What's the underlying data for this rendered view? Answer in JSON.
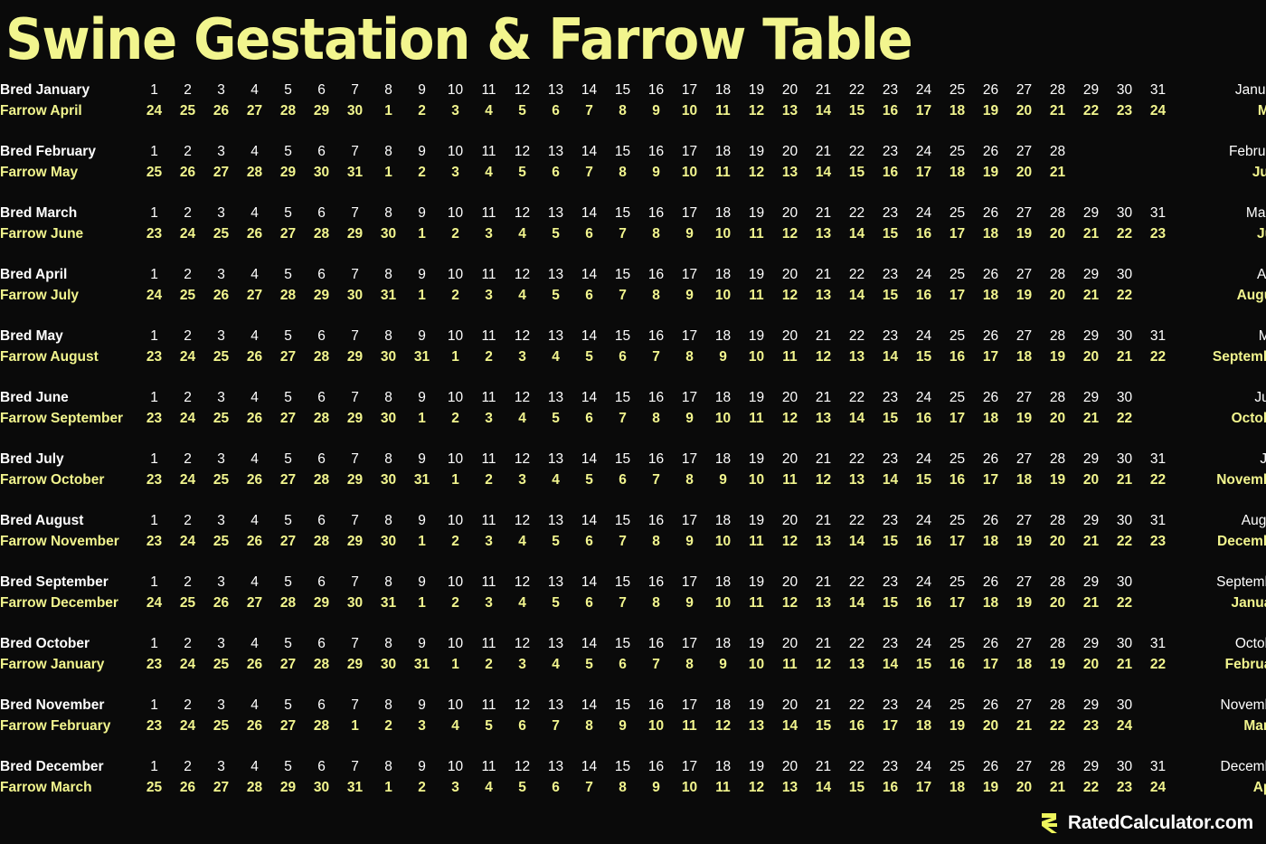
{
  "title": "Swine Gestation & Farrow Table",
  "colors": {
    "background": "#0a0a0a",
    "accent": "#f2f58e",
    "text": "#ffffff"
  },
  "footer": {
    "logo_icon": "rated-calculator-r-logo-icon",
    "brand": "RatedCalculator.com"
  },
  "table": {
    "bred_prefix": "Bred",
    "farrow_prefix": "Farrow",
    "max_columns": 31,
    "rows": [
      {
        "bred_label": "Bred January",
        "farrow_label": "Farrow April",
        "bred_month": "January",
        "farrow_month": "May",
        "bred_days": [
          1,
          2,
          3,
          4,
          5,
          6,
          7,
          8,
          9,
          10,
          11,
          12,
          13,
          14,
          15,
          16,
          17,
          18,
          19,
          20,
          21,
          22,
          23,
          24,
          25,
          26,
          27,
          28,
          29,
          30,
          31
        ],
        "farrow_days": [
          24,
          25,
          26,
          27,
          28,
          29,
          30,
          1,
          2,
          3,
          4,
          5,
          6,
          7,
          8,
          9,
          10,
          11,
          12,
          13,
          14,
          15,
          16,
          17,
          18,
          19,
          20,
          21,
          22,
          23,
          24
        ]
      },
      {
        "bred_label": "Bred February",
        "farrow_label": "Farrow May",
        "bred_month": "February",
        "farrow_month": "June",
        "bred_days": [
          1,
          2,
          3,
          4,
          5,
          6,
          7,
          8,
          9,
          10,
          11,
          12,
          13,
          14,
          15,
          16,
          17,
          18,
          19,
          20,
          21,
          22,
          23,
          24,
          25,
          26,
          27,
          28
        ],
        "farrow_days": [
          25,
          26,
          27,
          28,
          29,
          30,
          31,
          1,
          2,
          3,
          4,
          5,
          6,
          7,
          8,
          9,
          10,
          11,
          12,
          13,
          14,
          15,
          16,
          17,
          18,
          19,
          20,
          21
        ]
      },
      {
        "bred_label": "Bred March",
        "farrow_label": "Farrow June",
        "bred_month": "March",
        "farrow_month": "July",
        "bred_days": [
          1,
          2,
          3,
          4,
          5,
          6,
          7,
          8,
          9,
          10,
          11,
          12,
          13,
          14,
          15,
          16,
          17,
          18,
          19,
          20,
          21,
          22,
          23,
          24,
          25,
          26,
          27,
          28,
          29,
          30,
          31
        ],
        "farrow_days": [
          23,
          24,
          25,
          26,
          27,
          28,
          29,
          30,
          1,
          2,
          3,
          4,
          5,
          6,
          7,
          8,
          9,
          10,
          11,
          12,
          13,
          14,
          15,
          16,
          17,
          18,
          19,
          20,
          21,
          22,
          23
        ]
      },
      {
        "bred_label": "Bred April",
        "farrow_label": "Farrow July",
        "bred_month": "April",
        "farrow_month": "August",
        "bred_days": [
          1,
          2,
          3,
          4,
          5,
          6,
          7,
          8,
          9,
          10,
          11,
          12,
          13,
          14,
          15,
          16,
          17,
          18,
          19,
          20,
          21,
          22,
          23,
          24,
          25,
          26,
          27,
          28,
          29,
          30
        ],
        "farrow_days": [
          24,
          25,
          26,
          27,
          28,
          29,
          30,
          31,
          1,
          2,
          3,
          4,
          5,
          6,
          7,
          8,
          9,
          10,
          11,
          12,
          13,
          14,
          15,
          16,
          17,
          18,
          19,
          20,
          21,
          22
        ]
      },
      {
        "bred_label": "Bred May",
        "farrow_label": "Farrow August",
        "bred_month": "May",
        "farrow_month": "September",
        "bred_days": [
          1,
          2,
          3,
          4,
          5,
          6,
          7,
          8,
          9,
          10,
          11,
          12,
          13,
          14,
          15,
          16,
          17,
          18,
          19,
          20,
          21,
          22,
          23,
          24,
          25,
          26,
          27,
          28,
          29,
          30,
          31
        ],
        "farrow_days": [
          23,
          24,
          25,
          26,
          27,
          28,
          29,
          30,
          31,
          1,
          2,
          3,
          4,
          5,
          6,
          7,
          8,
          9,
          10,
          11,
          12,
          13,
          14,
          15,
          16,
          17,
          18,
          19,
          20,
          21,
          22
        ]
      },
      {
        "bred_label": "Bred June",
        "farrow_label": "Farrow September",
        "bred_month": "June",
        "farrow_month": "October",
        "bred_days": [
          1,
          2,
          3,
          4,
          5,
          6,
          7,
          8,
          9,
          10,
          11,
          12,
          13,
          14,
          15,
          16,
          17,
          18,
          19,
          20,
          21,
          22,
          23,
          24,
          25,
          26,
          27,
          28,
          29,
          30
        ],
        "farrow_days": [
          23,
          24,
          25,
          26,
          27,
          28,
          29,
          30,
          1,
          2,
          3,
          4,
          5,
          6,
          7,
          8,
          9,
          10,
          11,
          12,
          13,
          14,
          15,
          16,
          17,
          18,
          19,
          20,
          21,
          22
        ]
      },
      {
        "bred_label": "Bred July",
        "farrow_label": "Farrow October",
        "bred_month": "July",
        "farrow_month": "November",
        "bred_days": [
          1,
          2,
          3,
          4,
          5,
          6,
          7,
          8,
          9,
          10,
          11,
          12,
          13,
          14,
          15,
          16,
          17,
          18,
          19,
          20,
          21,
          22,
          23,
          24,
          25,
          26,
          27,
          28,
          29,
          30,
          31
        ],
        "farrow_days": [
          23,
          24,
          25,
          26,
          27,
          28,
          29,
          30,
          31,
          1,
          2,
          3,
          4,
          5,
          6,
          7,
          8,
          9,
          10,
          11,
          12,
          13,
          14,
          15,
          16,
          17,
          18,
          19,
          20,
          21,
          22
        ]
      },
      {
        "bred_label": "Bred August",
        "farrow_label": "Farrow November",
        "bred_month": "August",
        "farrow_month": "December",
        "bred_days": [
          1,
          2,
          3,
          4,
          5,
          6,
          7,
          8,
          9,
          10,
          11,
          12,
          13,
          14,
          15,
          16,
          17,
          18,
          19,
          20,
          21,
          22,
          23,
          24,
          25,
          26,
          27,
          28,
          29,
          30,
          31
        ],
        "farrow_days": [
          23,
          24,
          25,
          26,
          27,
          28,
          29,
          30,
          1,
          2,
          3,
          4,
          5,
          6,
          7,
          8,
          9,
          10,
          11,
          12,
          13,
          14,
          15,
          16,
          17,
          18,
          19,
          20,
          21,
          22,
          23
        ]
      },
      {
        "bred_label": "Bred September",
        "farrow_label": "Farrow December",
        "bred_month": "September",
        "farrow_month": "January",
        "bred_days": [
          1,
          2,
          3,
          4,
          5,
          6,
          7,
          8,
          9,
          10,
          11,
          12,
          13,
          14,
          15,
          16,
          17,
          18,
          19,
          20,
          21,
          22,
          23,
          24,
          25,
          26,
          27,
          28,
          29,
          30
        ],
        "farrow_days": [
          24,
          25,
          26,
          27,
          28,
          29,
          30,
          31,
          1,
          2,
          3,
          4,
          5,
          6,
          7,
          8,
          9,
          10,
          11,
          12,
          13,
          14,
          15,
          16,
          17,
          18,
          19,
          20,
          21,
          22
        ]
      },
      {
        "bred_label": "Bred October",
        "farrow_label": "Farrow January",
        "bred_month": "October",
        "farrow_month": "February",
        "bred_days": [
          1,
          2,
          3,
          4,
          5,
          6,
          7,
          8,
          9,
          10,
          11,
          12,
          13,
          14,
          15,
          16,
          17,
          18,
          19,
          20,
          21,
          22,
          23,
          24,
          25,
          26,
          27,
          28,
          29,
          30,
          31
        ],
        "farrow_days": [
          23,
          24,
          25,
          26,
          27,
          28,
          29,
          30,
          31,
          1,
          2,
          3,
          4,
          5,
          6,
          7,
          8,
          9,
          10,
          11,
          12,
          13,
          14,
          15,
          16,
          17,
          18,
          19,
          20,
          21,
          22
        ]
      },
      {
        "bred_label": "Bred November",
        "farrow_label": "Farrow February",
        "bred_month": "November",
        "farrow_month": "March",
        "bred_days": [
          1,
          2,
          3,
          4,
          5,
          6,
          7,
          8,
          9,
          10,
          11,
          12,
          13,
          14,
          15,
          16,
          17,
          18,
          19,
          20,
          21,
          22,
          23,
          24,
          25,
          26,
          27,
          28,
          29,
          30
        ],
        "farrow_days": [
          23,
          24,
          25,
          26,
          27,
          28,
          1,
          2,
          3,
          4,
          5,
          6,
          7,
          8,
          9,
          10,
          11,
          12,
          13,
          14,
          15,
          16,
          17,
          18,
          19,
          20,
          21,
          22,
          23,
          24
        ]
      },
      {
        "bred_label": "Bred December",
        "farrow_label": "Farrow March",
        "bred_month": "December",
        "farrow_month": "April",
        "bred_days": [
          1,
          2,
          3,
          4,
          5,
          6,
          7,
          8,
          9,
          10,
          11,
          12,
          13,
          14,
          15,
          16,
          17,
          18,
          19,
          20,
          21,
          22,
          23,
          24,
          25,
          26,
          27,
          28,
          29,
          30,
          31
        ],
        "farrow_days": [
          25,
          26,
          27,
          28,
          29,
          30,
          31,
          1,
          2,
          3,
          4,
          5,
          6,
          7,
          8,
          9,
          10,
          11,
          12,
          13,
          14,
          15,
          16,
          17,
          18,
          19,
          20,
          21,
          22,
          23,
          24
        ]
      }
    ]
  }
}
